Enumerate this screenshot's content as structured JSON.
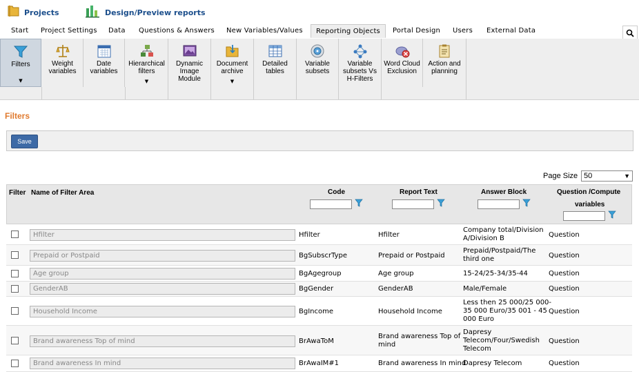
{
  "topnav": {
    "projects": "Projects",
    "design_preview": "Design/Preview reports"
  },
  "tabs": [
    "Start",
    "Project Settings",
    "Data",
    "Questions & Answers",
    "New Variables/Values",
    "Reporting Objects",
    "Portal Design",
    "Users",
    "External Data"
  ],
  "active_tab": "Reporting Objects",
  "ribbon": {
    "filters": "Filters",
    "weight_l1": "Weight",
    "weight_l2": "variables",
    "date_l1": "Date",
    "date_l2": "variables",
    "hier_l1": "Hierarchical",
    "hier_l2": "filters",
    "dyn_l1": "Dynamic",
    "dyn_l2": "Image",
    "dyn_l3": "Module",
    "doc_l1": "Document",
    "doc_l2": "archive",
    "detail_l1": "Detailed",
    "detail_l2": "tables",
    "varsub_l1": "Variable",
    "varsub_l2": "subsets",
    "varsubvs_l1": "Variable",
    "varsubvs_l2": "subsets Vs",
    "varsubvs_l3": "H-Filters",
    "wordcloud_l1": "Word Cloud",
    "wordcloud_l2": "Exclusion",
    "action_l1": "Action and",
    "action_l2": "planning"
  },
  "page_title": "Filters",
  "save_label": "Save",
  "page_size": {
    "label": "Page Size",
    "value": "50"
  },
  "columns": {
    "filter": "Filter",
    "name": "Name of Filter Area",
    "code": "Code",
    "report_text": "Report Text",
    "answer_block": "Answer Block",
    "question_l1": "Question /Compute",
    "question_l2": "variables"
  },
  "rows": [
    {
      "name": "Hfilter",
      "code": "Hfilter",
      "report_text": "Hfilter",
      "answer_l1": "Company total/Division",
      "answer_l2": "A/Division B",
      "answer_l3": "",
      "type": "Question"
    },
    {
      "name": "Prepaid or Postpaid",
      "code": "BgSubscrType",
      "report_text": "Prepaid or Postpaid",
      "answer_l1": "Prepaid/Postpaid/The",
      "answer_l2": "third one",
      "answer_l3": "",
      "type": "Question"
    },
    {
      "name": "Age group",
      "code": "BgAgegroup",
      "report_text": "Age group",
      "answer_l1": "15-24/25-34/35-44",
      "answer_l2": "",
      "answer_l3": "",
      "type": "Question"
    },
    {
      "name": "GenderAB",
      "code": "BgGender",
      "report_text": "GenderAB",
      "answer_l1": "Male/Female",
      "answer_l2": "",
      "answer_l3": "",
      "type": "Question"
    },
    {
      "name": "Household Income",
      "code": "BgIncome",
      "report_text": "Household Income",
      "answer_l1": "Less then 25 000/25 000-",
      "answer_l2": "35 000 Euro/35 001 - 45",
      "answer_l3": "000 Euro",
      "type": "Question"
    },
    {
      "name": "Brand awareness Top of mind",
      "code": "BrAwaToM",
      "report_text_l1": "Brand awareness Top of",
      "report_text_l2": "mind",
      "answer_l1": "Dapresy",
      "answer_l2": "Telecom/Four/Swedish",
      "answer_l3": "Telecom",
      "type": "Question"
    },
    {
      "name": "Brand awareness In mind",
      "code": "BrAwaIM#1",
      "report_text": "Brand awareness In mind",
      "answer_l1": "Dapresy Telecom",
      "answer_l2": "",
      "answer_l3": "",
      "type": "Question"
    }
  ],
  "colors": {
    "accent_orange": "#e07a2e",
    "link_blue": "#1c4f8c",
    "save_blue": "#3d6aa6",
    "funnel_blue": "#3aa0d8"
  }
}
